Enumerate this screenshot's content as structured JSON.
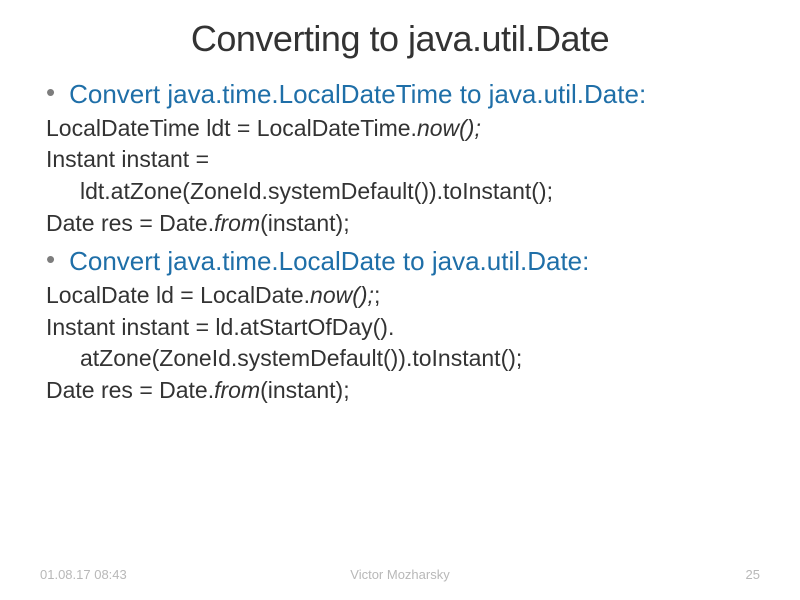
{
  "title": "Converting to java.util.Date",
  "sections": [
    {
      "heading": "Convert java.time.LocalDateTime to java.util.Date:",
      "lines": [
        {
          "text": "LocalDateTime ldt = LocalDateTime.",
          "italic": "now();",
          "indent": false
        },
        {
          "text": "Instant instant =",
          "italic": "",
          "indent": false
        },
        {
          "text": "ldt.atZone(ZoneId.systemDefault()).toInstant();",
          "italic": "",
          "indent": true
        },
        {
          "text": "Date res = Date.",
          "italic": "from",
          "after": "(instant);",
          "indent": false
        }
      ]
    },
    {
      "heading": "Convert java.time.LocalDate to java.util.Date:",
      "lines": [
        {
          "text": "LocalDate ld = LocalDate.",
          "italic": "now();",
          "after": ";",
          "indent": false
        },
        {
          "text": "Instant instant = ld.atStartOfDay().",
          "italic": "",
          "indent": false
        },
        {
          "text": "atZone(ZoneId.systemDefault()).toInstant();",
          "italic": "",
          "indent": true
        },
        {
          "text": "Date res = Date.",
          "italic": "from",
          "after": "(instant);",
          "indent": false
        }
      ]
    }
  ],
  "footer": {
    "date": "01.08.17 08:43",
    "author": "Victor Mozharsky",
    "page": "25"
  }
}
